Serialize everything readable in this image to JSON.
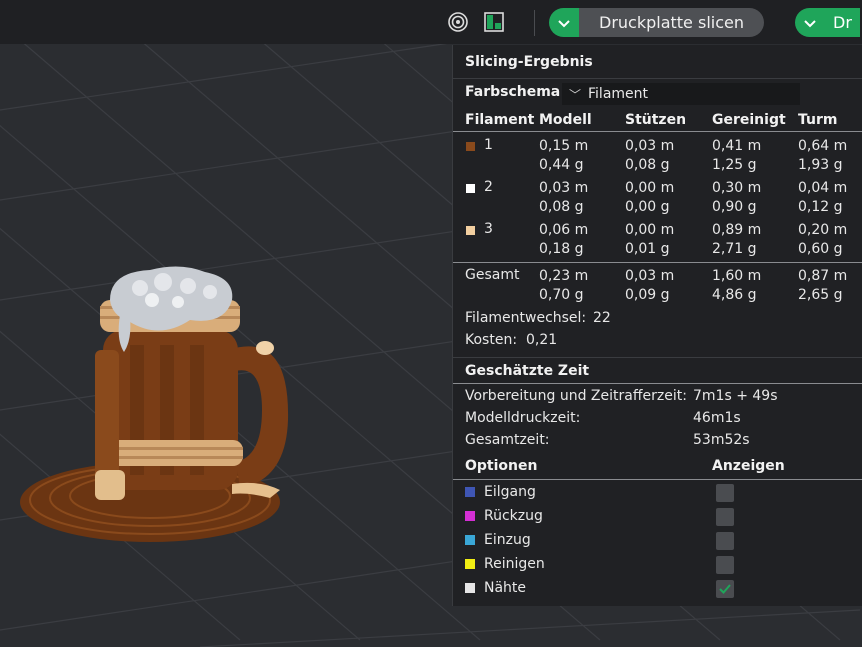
{
  "toolbar": {
    "slice_label": "Druckplatte slicen",
    "next_label": "Dr"
  },
  "panel": {
    "title": "Slicing-Ergebnis",
    "scheme_label": "Farbschema",
    "scheme_value": "Filament",
    "headers": [
      "Filament",
      "Modell",
      "Stützen",
      "Gereinigt",
      "Turm"
    ],
    "filaments": [
      {
        "id": "1",
        "color": "#8a4a1c",
        "modell": [
          "0,15 m",
          "0,44 g"
        ],
        "stuetzen": [
          "0,03 m",
          "0,08 g"
        ],
        "gereinigt": [
          "0,41 m",
          "1,25 g"
        ],
        "turm": [
          "0,64 m",
          "1,93 g"
        ]
      },
      {
        "id": "2",
        "color": "#ffffff",
        "modell": [
          "0,03 m",
          "0,08 g"
        ],
        "stuetzen": [
          "0,00 m",
          "0,00 g"
        ],
        "gereinigt": [
          "0,30 m",
          "0,90 g"
        ],
        "turm": [
          "0,04 m",
          "0,12 g"
        ]
      },
      {
        "id": "3",
        "color": "#f2cfa0",
        "modell": [
          "0,06 m",
          "0,18 g"
        ],
        "stuetzen": [
          "0,00 m",
          "0,01 g"
        ],
        "gereinigt": [
          "0,89 m",
          "2,71 g"
        ],
        "turm": [
          "0,20 m",
          "0,60 g"
        ]
      }
    ],
    "total": {
      "label": "Gesamt",
      "modell": [
        "0,23 m",
        "0,70 g"
      ],
      "stuetzen": [
        "0,03 m",
        "0,09 g"
      ],
      "gereinigt": [
        "1,60 m",
        "4,86 g"
      ],
      "turm": [
        "0,87 m",
        "2,65 g"
      ]
    },
    "changes_label": "Filamentwechsel:",
    "changes_value": "22",
    "cost_label": "Kosten:",
    "cost_value": "0,21",
    "time_title": "Geschätzte Zeit",
    "times": [
      {
        "label": "Vorbereitung und Zeitrafferzeit:",
        "value": "7m1s + 49s"
      },
      {
        "label": "Modelldruckzeit:",
        "value": "46m1s"
      },
      {
        "label": "Gesamtzeit:",
        "value": "53m52s"
      }
    ],
    "options_header": "Optionen",
    "show_header": "Anzeigen",
    "options": [
      {
        "label": "Eilgang",
        "color": "#3f56b5",
        "checked": false
      },
      {
        "label": "Rückzug",
        "color": "#d42fd4",
        "checked": false
      },
      {
        "label": "Einzug",
        "color": "#3aa7d6",
        "checked": false
      },
      {
        "label": "Reinigen",
        "color": "#f1ee14",
        "checked": false
      },
      {
        "label": "Nähte",
        "color": "#e6e6e6",
        "checked": true
      }
    ]
  }
}
